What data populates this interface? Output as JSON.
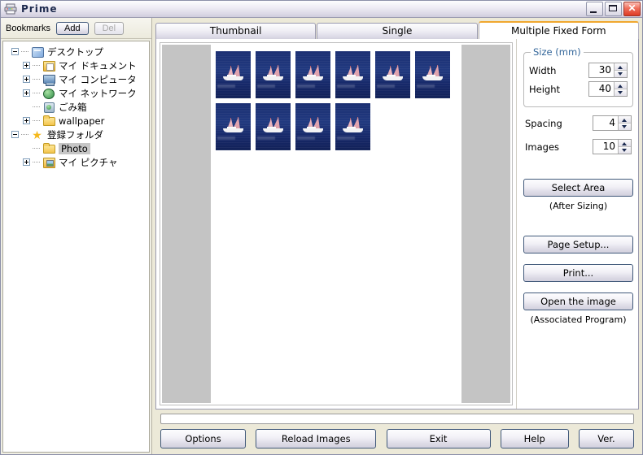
{
  "window": {
    "title": "Prime",
    "icon": "printer-icon",
    "minimize_label": "",
    "maximize_label": "",
    "close_label": "✕"
  },
  "sidebar": {
    "bookmarks_label": "Bookmarks",
    "add_label": "Add",
    "del_label": "Del",
    "del_disabled": true,
    "tree": [
      {
        "label": "デスクトップ",
        "icon": "desktop-icon",
        "indent": 0,
        "expander": "minus",
        "selected": false
      },
      {
        "label": "マイ ドキュメント",
        "icon": "documents-icon",
        "indent": 1,
        "expander": "plus",
        "selected": false
      },
      {
        "label": "マイ コンピュータ",
        "icon": "computer-icon",
        "indent": 1,
        "expander": "plus",
        "selected": false
      },
      {
        "label": "マイ ネットワーク",
        "icon": "network-icon",
        "indent": 1,
        "expander": "plus",
        "selected": false
      },
      {
        "label": "ごみ箱",
        "icon": "trash-icon",
        "indent": 1,
        "expander": "none",
        "selected": false
      },
      {
        "label": "wallpaper",
        "icon": "folder-icon",
        "indent": 1,
        "expander": "plus",
        "selected": false
      },
      {
        "label": "登録フォルダ",
        "icon": "star-icon",
        "indent": 0,
        "expander": "minus",
        "selected": false
      },
      {
        "label": "Photo",
        "icon": "folder-icon",
        "indent": 1,
        "expander": "none",
        "selected": true
      },
      {
        "label": "マイ ピクチャ",
        "icon": "pictures-icon",
        "indent": 1,
        "expander": "plus",
        "selected": false
      }
    ]
  },
  "tabs": [
    {
      "label": "Thumbnail",
      "active": false
    },
    {
      "label": "Single",
      "active": false
    },
    {
      "label": "Multiple Fixed Form",
      "active": true
    }
  ],
  "preview": {
    "image_count": 10,
    "thumbnail_alt": "sailboat-photo"
  },
  "settings": {
    "size_group_title": "Size (mm)",
    "width_label": "Width",
    "width_value": "30",
    "height_label": "Height",
    "height_value": "40",
    "spacing_label": "Spacing",
    "spacing_value": "4",
    "images_label": "Images",
    "images_value": "10",
    "select_area_label": "Select Area",
    "after_sizing_note": "(After Sizing)",
    "page_setup_label": "Page Setup...",
    "print_label": "Print...",
    "open_image_label": "Open the image",
    "associated_note": "(Associated Program)"
  },
  "bottom": {
    "progress_value": 0,
    "options_label": "Options",
    "reload_label": "Reload Images",
    "exit_label": "Exit",
    "help_label": "Help",
    "ver_label": "Ver."
  },
  "colors": {
    "accent_tab": "#f0a830",
    "group_title": "#33669a",
    "button_border": "#41597a",
    "page_margin": "#c4c4c4",
    "sea": "#1b2f72",
    "sail": "#e0a3ae"
  }
}
